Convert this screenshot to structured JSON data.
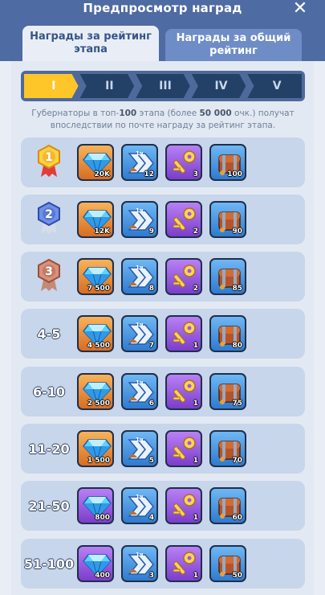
{
  "header": {
    "title": "Предпросмотр наград",
    "close_glyph": "✕"
  },
  "tabs": [
    {
      "label": "Награды за рейтинг этапа",
      "active": true
    },
    {
      "label": "Награды за общий рейтинг",
      "active": false
    }
  ],
  "stages": [
    {
      "label": "I",
      "active": true
    },
    {
      "label": "II",
      "active": false
    },
    {
      "label": "III",
      "active": false
    },
    {
      "label": "IV",
      "active": false
    },
    {
      "label": "V",
      "active": false
    }
  ],
  "description": {
    "part1": "Губернаторы в топ-",
    "bold1": "100",
    "part2": " этапа (более ",
    "bold2": "50 000",
    "part3": " очк.) получат впоследствии по почте награду за рейтинг этапа."
  },
  "rows": [
    {
      "rank_label": "",
      "rank_icon": "gold-medal-1-icon",
      "rewards": [
        "20K",
        "12",
        "3",
        "100"
      ],
      "gem_bg": "orange"
    },
    {
      "rank_label": "",
      "rank_icon": "silver-medal-2-icon",
      "rewards": [
        "12K",
        "9",
        "2",
        "90"
      ],
      "gem_bg": "orange"
    },
    {
      "rank_label": "",
      "rank_icon": "bronze-medal-3-icon",
      "rewards": [
        "7 500",
        "8",
        "2",
        "85"
      ],
      "gem_bg": "orange"
    },
    {
      "rank_label": "4-5",
      "rewards": [
        "4 500",
        "7",
        "1",
        "80"
      ],
      "gem_bg": "orange"
    },
    {
      "rank_label": "6-10",
      "rewards": [
        "2 500",
        "6",
        "1",
        "75"
      ],
      "gem_bg": "orange"
    },
    {
      "rank_label": "11-20",
      "rewards": [
        "1 500",
        "5",
        "1",
        "70"
      ],
      "gem_bg": "orange"
    },
    {
      "rank_label": "21-50",
      "rewards": [
        "800",
        "4",
        "1",
        "60"
      ],
      "gem_bg": "purple"
    },
    {
      "rank_label": "51-100",
      "rewards": [
        "400",
        "3",
        "1",
        "50"
      ],
      "gem_bg": "purple"
    }
  ],
  "reward_icons": [
    "gems-icon",
    "speedup-icon",
    "golden-key-icon",
    "treasure-chest-icon"
  ],
  "colors": {
    "header": "#4f6ba3",
    "active_stage": "#ffc629",
    "row_bg": "#c7d6ea"
  }
}
